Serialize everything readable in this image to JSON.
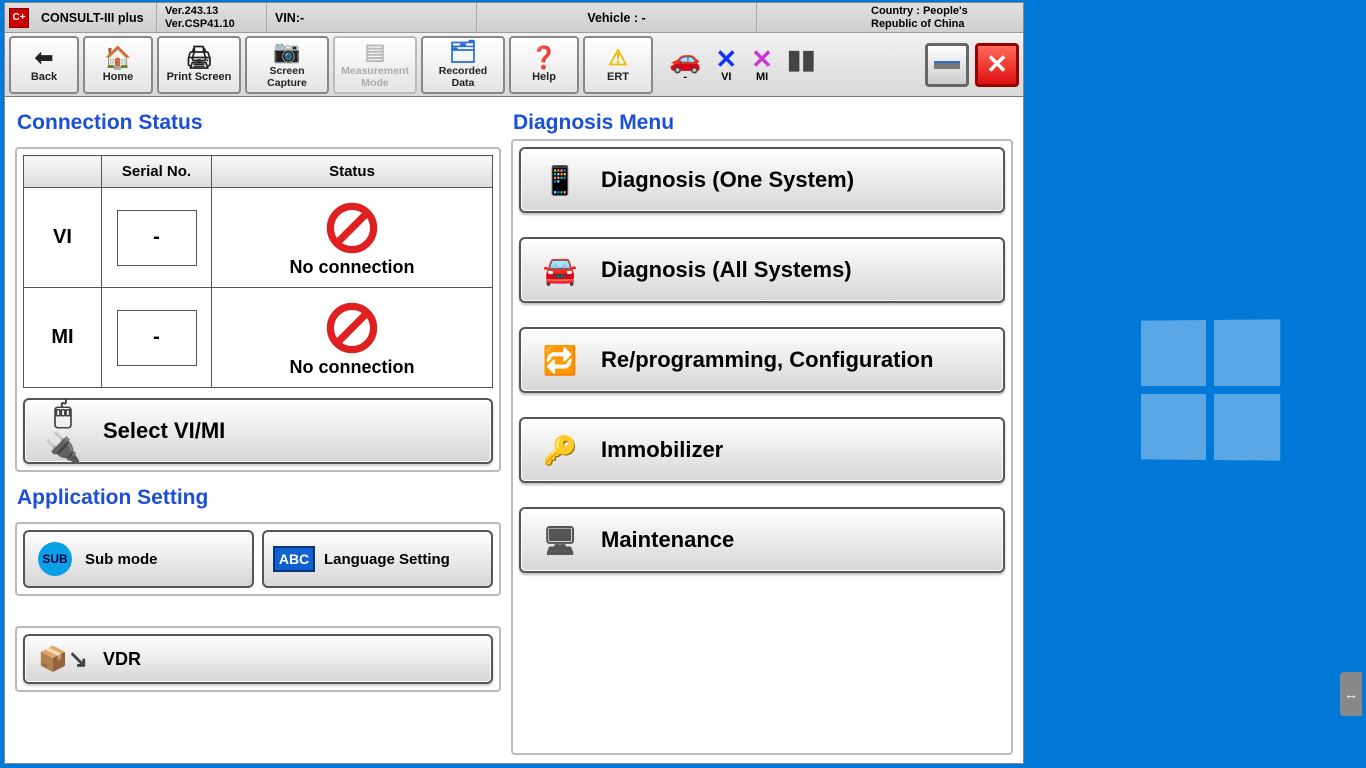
{
  "titlebar": {
    "logo_text": "C+",
    "app_name": "CONSULT-III plus",
    "version1": "Ver.243.13",
    "version2": "Ver.CSP41.10",
    "vin_label": "VIN:-",
    "vehicle_label": "Vehicle : -",
    "country_line1": "Country : People's",
    "country_line2": "Republic of China"
  },
  "toolbar": {
    "back": "Back",
    "home": "Home",
    "print": "Print Screen",
    "capture1": "Screen",
    "capture2": "Capture",
    "measure1": "Measurement",
    "measure2": "Mode",
    "recorded1": "Recorded",
    "recorded2": "Data",
    "help": "Help",
    "ert": "ERT",
    "dash": "-",
    "vi": "VI",
    "mi": "MI"
  },
  "connection": {
    "title": "Connection Status",
    "col_serial": "Serial No.",
    "col_status": "Status",
    "rows": [
      {
        "label": "VI",
        "serial": "-",
        "status": "No connection"
      },
      {
        "label": "MI",
        "serial": "-",
        "status": "No connection"
      }
    ],
    "select_btn": "Select VI/MI"
  },
  "appsetting": {
    "title": "Application Setting",
    "sub_mode": "Sub mode",
    "sub_badge": "SUB",
    "lang": "Language Setting",
    "abc": "ABC",
    "vdr": "VDR"
  },
  "diagnosis": {
    "title": "Diagnosis Menu",
    "items": [
      "Diagnosis (One System)",
      "Diagnosis (All Systems)",
      "Re/programming, Configuration",
      "Immobilizer",
      "Maintenance"
    ]
  },
  "colors": {
    "accent_blue": "#1a4fd6",
    "car_blue": "#1a9ff0",
    "x_blue": "#1030ff",
    "x_magenta": "#c838d0",
    "prohibit_red": "#e02020"
  }
}
